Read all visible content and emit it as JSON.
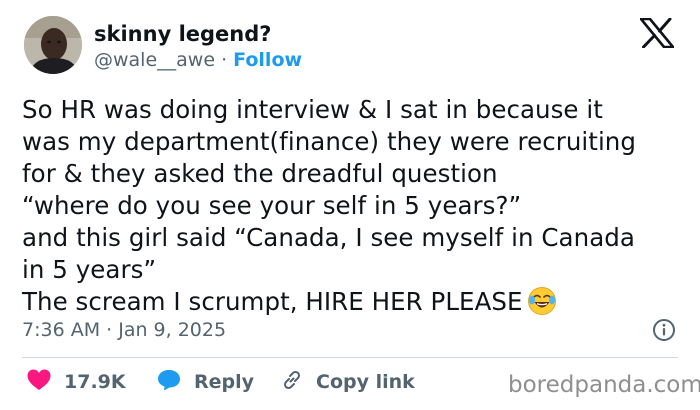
{
  "user": {
    "display_name": "skinny legend?",
    "handle": "@wale__awe",
    "separator": " · ",
    "follow_label": "Follow"
  },
  "tweet": {
    "text": "So HR was doing interview & I sat in because it\nwas my department(finance) they were recruiting\nfor & they asked the dreadful question\n“where do you see your self in 5 years?”\nand this girl said “Canada, I see myself in Canada\nin 5 years”\nThe scream I scrumpt, HIRE HER PLEASE",
    "emoji": "face-with-tears-of-joy",
    "timestamp": "7:36 AM · Jan 9, 2025"
  },
  "actions": {
    "like_count": "17.9K",
    "reply_label": "Reply",
    "copy_link_label": "Copy link"
  },
  "watermark": "boredpanda.com",
  "icons": {
    "brand": "x-logo-icon",
    "info": "info-icon",
    "like": "heart-icon",
    "reply": "reply-bubble-icon",
    "copy": "link-icon"
  },
  "colors": {
    "text": "#0f1419",
    "secondary": "#536471",
    "follow": "#1d9bf0",
    "like": "#f91880",
    "reply": "#1d9bf0",
    "divider": "#cfd9de"
  }
}
